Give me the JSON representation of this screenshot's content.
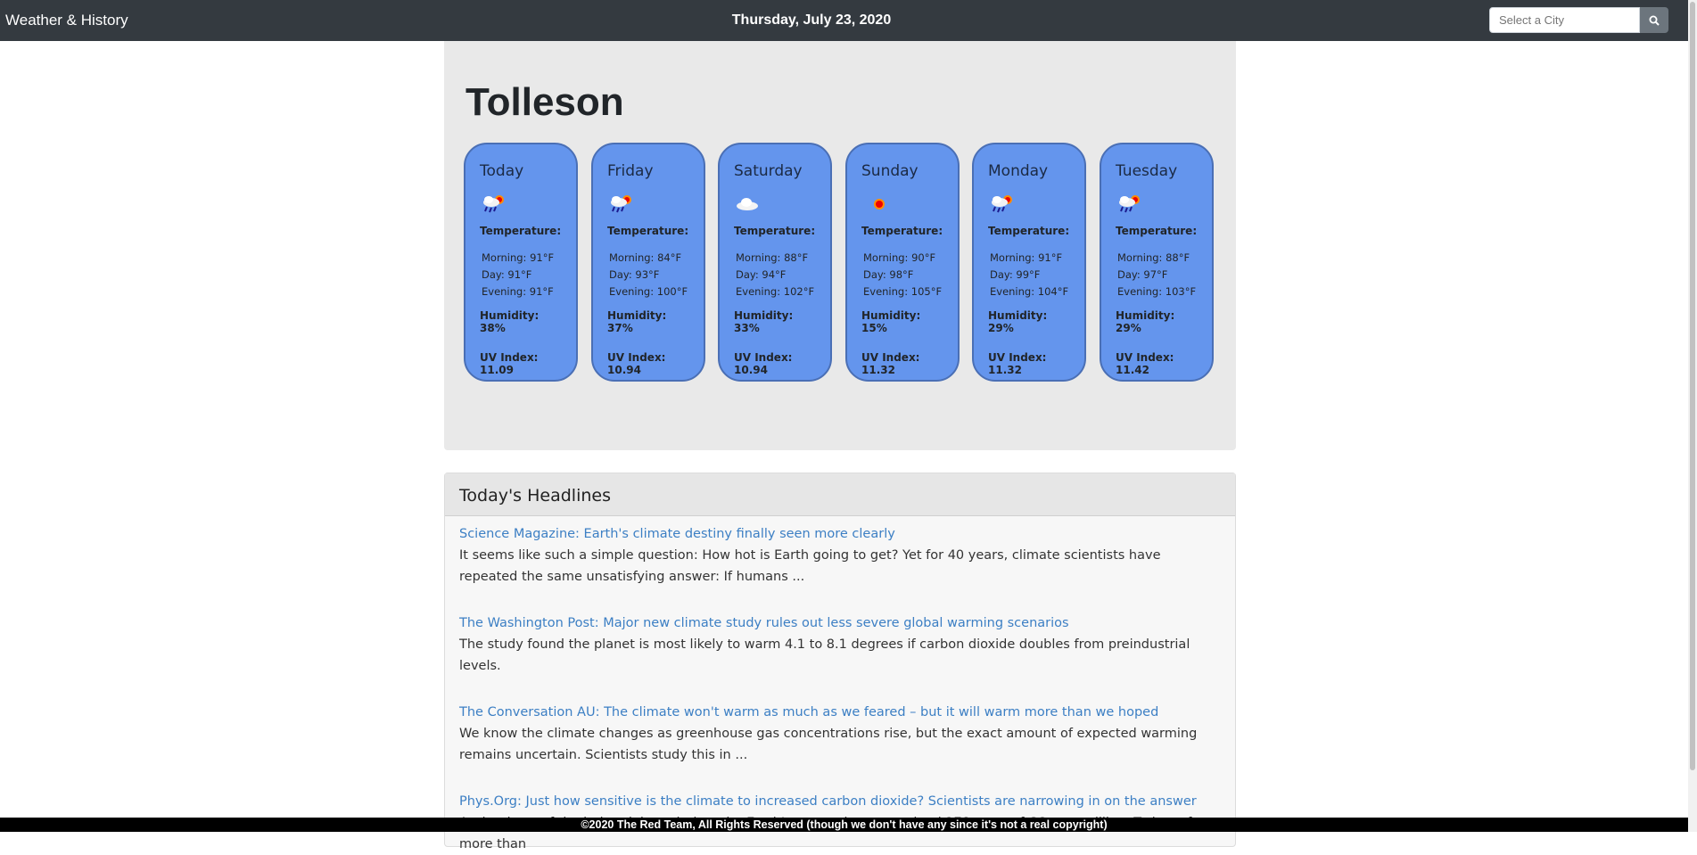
{
  "nav": {
    "brand": "Weather & History",
    "date": "Thursday, July 23, 2020",
    "search_placeholder": "Select a City"
  },
  "weather": {
    "city": "Tolleson",
    "days": [
      {
        "day": "Today",
        "icon": "rain-sun-icon",
        "label": "Temperature:",
        "morning": "Morning: 91°F",
        "day_temp": "Day: 91°F",
        "evening": "Evening: 91°F",
        "humidity": "Humidity: 38%",
        "uv": "UV Index: 11.09"
      },
      {
        "day": "Friday",
        "icon": "rain-sun-icon",
        "label": "Temperature:",
        "morning": "Morning: 84°F",
        "day_temp": "Day: 93°F",
        "evening": "Evening: 100°F",
        "humidity": "Humidity: 37%",
        "uv": "UV Index: 10.94"
      },
      {
        "day": "Saturday",
        "icon": "cloud-icon",
        "label": "Temperature:",
        "morning": "Morning: 88°F",
        "day_temp": "Day: 94°F",
        "evening": "Evening: 102°F",
        "humidity": "Humidity: 33%",
        "uv": "UV Index: 10.94"
      },
      {
        "day": "Sunday",
        "icon": "sun-icon",
        "label": "Temperature:",
        "morning": "Morning: 90°F",
        "day_temp": "Day: 98°F",
        "evening": "Evening: 105°F",
        "humidity": "Humidity: 15%",
        "uv": "UV Index: 11.32"
      },
      {
        "day": "Monday",
        "icon": "rain-sun-icon",
        "label": "Temperature:",
        "morning": "Morning: 91°F",
        "day_temp": "Day: 99°F",
        "evening": "Evening: 104°F",
        "humidity": "Humidity: 29%",
        "uv": "UV Index: 11.32"
      },
      {
        "day": "Tuesday",
        "icon": "rain-sun-icon",
        "label": "Temperature:",
        "morning": "Morning: 88°F",
        "day_temp": "Day: 97°F",
        "evening": "Evening: 103°F",
        "humidity": "Humidity: 29%",
        "uv": "UV Index: 11.42"
      }
    ]
  },
  "headlines": {
    "title": "Today's Headlines",
    "items": [
      {
        "link": "Science Magazine: Earth's climate destiny finally seen more clearly",
        "desc": "It seems like such a simple question: How hot is Earth going to get? Yet for 40 years, climate scientists have repeated the same unsatisfying answer: If humans ..."
      },
      {
        "link": "The Washington Post: Major new climate study rules out less severe global warming scenarios",
        "desc": "The study found the planet is most likely to warm 4.1 to 8.1 degrees if carbon dioxide doubles from preindustrial levels."
      },
      {
        "link": "The Conversation AU: The climate won't warm as much as we feared – but it will warm more than we hoped",
        "desc": "We know the climate changes as greenhouse gas concentrations rise, but the exact amount of expected warming remains uncertain. Scientists study this in ..."
      },
      {
        "link": "Phys.Org: Just how sensitive is the climate to increased carbon dioxide? Scientists are narrowing in on the answer",
        "desc": "At the dawn of the industrial revolution, the Earth's atmosphere contained 278 parts of CO₂ per million. Today, after more than"
      }
    ]
  },
  "footer": {
    "text": "©2020 The Red Team, All Rights Reserved (though we don't have any since it's not a real copyright)"
  },
  "colors": {
    "navbar": "#343a40",
    "card": "#6495ed",
    "link": "#3c7fc4"
  }
}
